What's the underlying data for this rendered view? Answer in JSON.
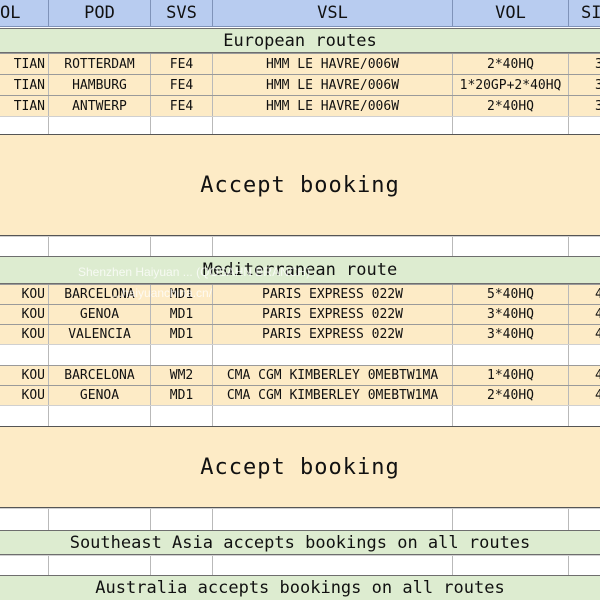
{
  "headers": [
    "OL",
    "POD",
    "SVS",
    "VSL",
    "VOL",
    "SI"
  ],
  "european": {
    "title": "European routes",
    "rows": [
      {
        "pol": "TIAN",
        "pod": "ROTTERDAM",
        "svs": "FE4",
        "vsl": "HMM LE HAVRE/006W",
        "vol": "2*40HQ",
        "si": "3"
      },
      {
        "pol": "TIAN",
        "pod": "HAMBURG",
        "svs": "FE4",
        "vsl": "HMM LE HAVRE/006W",
        "vol": "1*20GP+2*40HQ",
        "si": "3"
      },
      {
        "pol": "TIAN",
        "pod": "ANTWERP",
        "svs": "FE4",
        "vsl": "HMM LE HAVRE/006W",
        "vol": "2*40HQ",
        "si": "3"
      }
    ]
  },
  "accept_1": "Accept booking",
  "mediterranean": {
    "title": "Mediterranean route",
    "rows_a": [
      {
        "pol": "KOU",
        "pod": "BARCELONA",
        "svs": "MD1",
        "vsl": "PARIS EXPRESS 022W",
        "vol": "5*40HQ",
        "si": "4"
      },
      {
        "pol": "KOU",
        "pod": "GENOA",
        "svs": "MD1",
        "vsl": "PARIS EXPRESS 022W",
        "vol": "3*40HQ",
        "si": "4"
      },
      {
        "pol": "KOU",
        "pod": "VALENCIA",
        "svs": "MD1",
        "vsl": "PARIS EXPRESS 022W",
        "vol": "3*40HQ",
        "si": "4"
      }
    ],
    "rows_b": [
      {
        "pol": "KOU",
        "pod": "BARCELONA",
        "svs": "WM2",
        "vsl": "CMA CGM KIMBERLEY 0MEBTW1MA",
        "vol": "1*40HQ",
        "si": "4"
      },
      {
        "pol": "KOU",
        "pod": "GENOA",
        "svs": "MD1",
        "vsl": "CMA CGM KIMBERLEY 0MEBTW1MA",
        "vol": "2*40HQ",
        "si": "4"
      }
    ]
  },
  "accept_2": "Accept booking",
  "southeast_asia": "Southeast Asia accepts bookings on all routes",
  "australia": "Australia accepts bookings on all routes",
  "watermark": {
    "line1": "Shenzhen Haiyuan ... (QOSAHN BRANCH)",
    "line2": "...haiyuanchina.cn/"
  }
}
